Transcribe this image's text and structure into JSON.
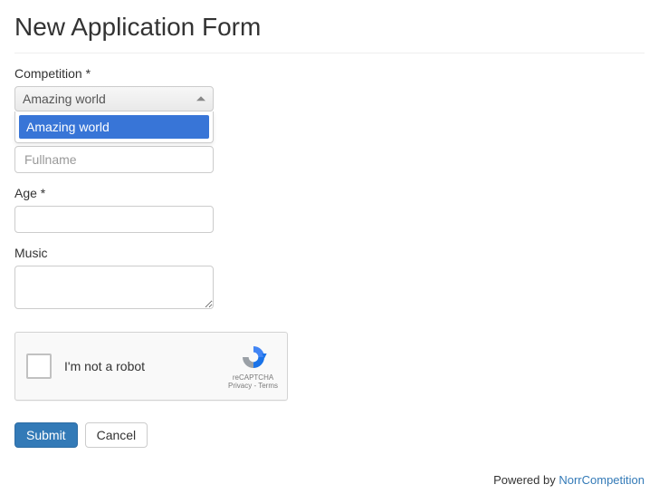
{
  "title": "New Application Form",
  "fields": {
    "competition": {
      "label": "Competition *",
      "selected": "Amazing world",
      "options": [
        "Amazing world"
      ]
    },
    "fullname": {
      "placeholder": "Fullname",
      "value": ""
    },
    "age": {
      "label": "Age *",
      "value": ""
    },
    "music": {
      "label": "Music",
      "value": ""
    }
  },
  "recaptcha": {
    "label": "I'm not a robot",
    "brand": "reCAPTCHA",
    "links": "Privacy - Terms"
  },
  "buttons": {
    "submit": "Submit",
    "cancel": "Cancel"
  },
  "footer": {
    "text": "Powered by ",
    "link": "NorrCompetition"
  }
}
